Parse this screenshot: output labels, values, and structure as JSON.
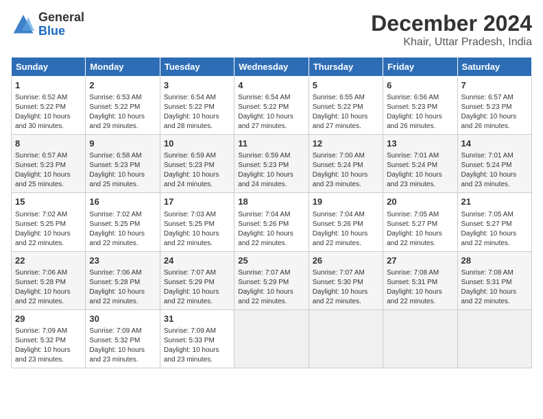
{
  "header": {
    "logo_general": "General",
    "logo_blue": "Blue",
    "title": "December 2024",
    "subtitle": "Khair, Uttar Pradesh, India"
  },
  "days_of_week": [
    "Sunday",
    "Monday",
    "Tuesday",
    "Wednesday",
    "Thursday",
    "Friday",
    "Saturday"
  ],
  "weeks": [
    [
      {
        "day": "1",
        "info": "Sunrise: 6:52 AM\nSunset: 5:22 PM\nDaylight: 10 hours\nand 30 minutes."
      },
      {
        "day": "2",
        "info": "Sunrise: 6:53 AM\nSunset: 5:22 PM\nDaylight: 10 hours\nand 29 minutes."
      },
      {
        "day": "3",
        "info": "Sunrise: 6:54 AM\nSunset: 5:22 PM\nDaylight: 10 hours\nand 28 minutes."
      },
      {
        "day": "4",
        "info": "Sunrise: 6:54 AM\nSunset: 5:22 PM\nDaylight: 10 hours\nand 27 minutes."
      },
      {
        "day": "5",
        "info": "Sunrise: 6:55 AM\nSunset: 5:22 PM\nDaylight: 10 hours\nand 27 minutes."
      },
      {
        "day": "6",
        "info": "Sunrise: 6:56 AM\nSunset: 5:23 PM\nDaylight: 10 hours\nand 26 minutes."
      },
      {
        "day": "7",
        "info": "Sunrise: 6:57 AM\nSunset: 5:23 PM\nDaylight: 10 hours\nand 26 minutes."
      }
    ],
    [
      {
        "day": "8",
        "info": "Sunrise: 6:57 AM\nSunset: 5:23 PM\nDaylight: 10 hours\nand 25 minutes."
      },
      {
        "day": "9",
        "info": "Sunrise: 6:58 AM\nSunset: 5:23 PM\nDaylight: 10 hours\nand 25 minutes."
      },
      {
        "day": "10",
        "info": "Sunrise: 6:59 AM\nSunset: 5:23 PM\nDaylight: 10 hours\nand 24 minutes."
      },
      {
        "day": "11",
        "info": "Sunrise: 6:59 AM\nSunset: 5:23 PM\nDaylight: 10 hours\nand 24 minutes."
      },
      {
        "day": "12",
        "info": "Sunrise: 7:00 AM\nSunset: 5:24 PM\nDaylight: 10 hours\nand 23 minutes."
      },
      {
        "day": "13",
        "info": "Sunrise: 7:01 AM\nSunset: 5:24 PM\nDaylight: 10 hours\nand 23 minutes."
      },
      {
        "day": "14",
        "info": "Sunrise: 7:01 AM\nSunset: 5:24 PM\nDaylight: 10 hours\nand 23 minutes."
      }
    ],
    [
      {
        "day": "15",
        "info": "Sunrise: 7:02 AM\nSunset: 5:25 PM\nDaylight: 10 hours\nand 22 minutes."
      },
      {
        "day": "16",
        "info": "Sunrise: 7:02 AM\nSunset: 5:25 PM\nDaylight: 10 hours\nand 22 minutes."
      },
      {
        "day": "17",
        "info": "Sunrise: 7:03 AM\nSunset: 5:25 PM\nDaylight: 10 hours\nand 22 minutes."
      },
      {
        "day": "18",
        "info": "Sunrise: 7:04 AM\nSunset: 5:26 PM\nDaylight: 10 hours\nand 22 minutes."
      },
      {
        "day": "19",
        "info": "Sunrise: 7:04 AM\nSunset: 5:26 PM\nDaylight: 10 hours\nand 22 minutes."
      },
      {
        "day": "20",
        "info": "Sunrise: 7:05 AM\nSunset: 5:27 PM\nDaylight: 10 hours\nand 22 minutes."
      },
      {
        "day": "21",
        "info": "Sunrise: 7:05 AM\nSunset: 5:27 PM\nDaylight: 10 hours\nand 22 minutes."
      }
    ],
    [
      {
        "day": "22",
        "info": "Sunrise: 7:06 AM\nSunset: 5:28 PM\nDaylight: 10 hours\nand 22 minutes."
      },
      {
        "day": "23",
        "info": "Sunrise: 7:06 AM\nSunset: 5:28 PM\nDaylight: 10 hours\nand 22 minutes."
      },
      {
        "day": "24",
        "info": "Sunrise: 7:07 AM\nSunset: 5:29 PM\nDaylight: 10 hours\nand 22 minutes."
      },
      {
        "day": "25",
        "info": "Sunrise: 7:07 AM\nSunset: 5:29 PM\nDaylight: 10 hours\nand 22 minutes."
      },
      {
        "day": "26",
        "info": "Sunrise: 7:07 AM\nSunset: 5:30 PM\nDaylight: 10 hours\nand 22 minutes."
      },
      {
        "day": "27",
        "info": "Sunrise: 7:08 AM\nSunset: 5:31 PM\nDaylight: 10 hours\nand 22 minutes."
      },
      {
        "day": "28",
        "info": "Sunrise: 7:08 AM\nSunset: 5:31 PM\nDaylight: 10 hours\nand 22 minutes."
      }
    ],
    [
      {
        "day": "29",
        "info": "Sunrise: 7:09 AM\nSunset: 5:32 PM\nDaylight: 10 hours\nand 23 minutes."
      },
      {
        "day": "30",
        "info": "Sunrise: 7:09 AM\nSunset: 5:32 PM\nDaylight: 10 hours\nand 23 minutes."
      },
      {
        "day": "31",
        "info": "Sunrise: 7:09 AM\nSunset: 5:33 PM\nDaylight: 10 hours\nand 23 minutes."
      },
      {
        "day": "",
        "info": ""
      },
      {
        "day": "",
        "info": ""
      },
      {
        "day": "",
        "info": ""
      },
      {
        "day": "",
        "info": ""
      }
    ]
  ]
}
